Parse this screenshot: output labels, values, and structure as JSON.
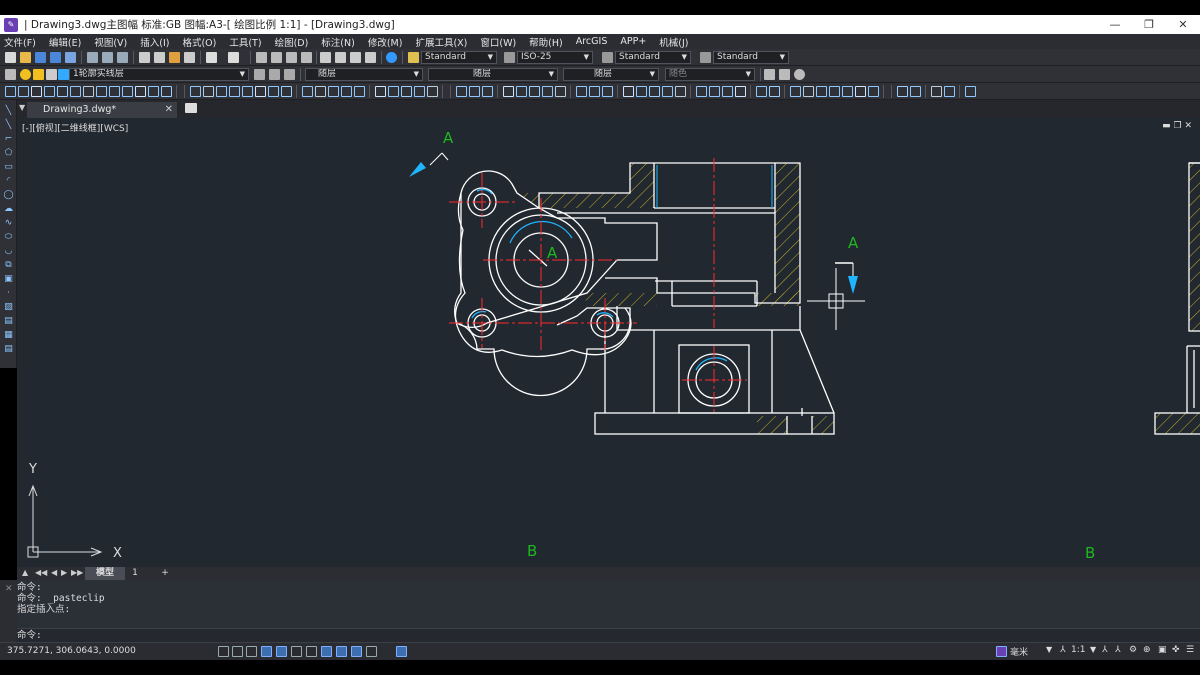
{
  "window": {
    "title": "| Drawing3.dwg主图幅 标准:GB 图幅:A3-[ 绘图比例 1:1] - [Drawing3.dwg]",
    "controls": [
      "—",
      "❐",
      "✕"
    ]
  },
  "menu": [
    "文件(F)",
    "编辑(E)",
    "视图(V)",
    "插入(I)",
    "格式(O)",
    "工具(T)",
    "绘图(D)",
    "标注(N)",
    "修改(M)",
    "扩展工具(X)",
    "窗口(W)",
    "帮助(H)",
    "ArcGIS",
    "APP+",
    "机械(J)"
  ],
  "toolbar1": {
    "text_style": "Standard",
    "dim_style": "ISO-25",
    "table_style": "Standard",
    "multileader_style": "Standard"
  },
  "toolbar2": {
    "layer": "1轮廓实线层",
    "color": "随层",
    "linetype": "随层",
    "lineweight": "随层",
    "plotstyle": "随色"
  },
  "tabs": {
    "document": "Drawing3.dwg*",
    "close": "✕"
  },
  "viewport": {
    "label": "[-][俯视][二维线框][WCS]",
    "controls": "▬ ❐ ✕",
    "ucs_x": "X",
    "ucs_y": "Y",
    "section_labels": {
      "a_top": "A",
      "a_center": "A",
      "a_right": "A",
      "b_left": "B",
      "b_right": "B"
    }
  },
  "layout_tabs": {
    "model": "模型",
    "layout1": "1",
    "add": "+"
  },
  "command": {
    "history": [
      "命令:",
      "命令: _pasteclip",
      "指定插入点:"
    ],
    "prompt": "命令:"
  },
  "status": {
    "coordinates": "375.7271, 306.0643, 0.0000",
    "units": "毫米",
    "scale": "1:1"
  },
  "colors": {
    "canvas": "#212830",
    "geometry": "#ffffff",
    "centerline": "#ff2a2a",
    "hatch": "#c8b22a",
    "arrow": "#1fb6ff",
    "label": "#1fb61f"
  }
}
